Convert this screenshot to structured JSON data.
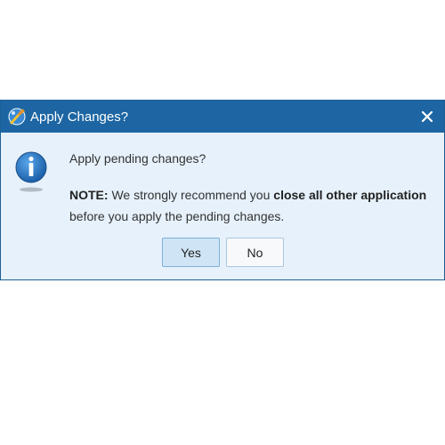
{
  "dialog": {
    "title": "Apply Changes?",
    "close_label": "X",
    "question": "Apply pending changes?",
    "note": {
      "prefix": "NOTE:",
      "text1": " We strongly recommend you ",
      "emphasis": "close all other application",
      "line2": "before you apply the pending changes."
    },
    "buttons": {
      "yes": "Yes",
      "no": "No"
    },
    "icons": {
      "app": "app-logo-icon",
      "info": "info-icon",
      "close": "close-icon"
    },
    "colors": {
      "titlebar": "#1d66a3",
      "body": "#e6f1fb",
      "primary_button": "#cfe5f6"
    }
  }
}
